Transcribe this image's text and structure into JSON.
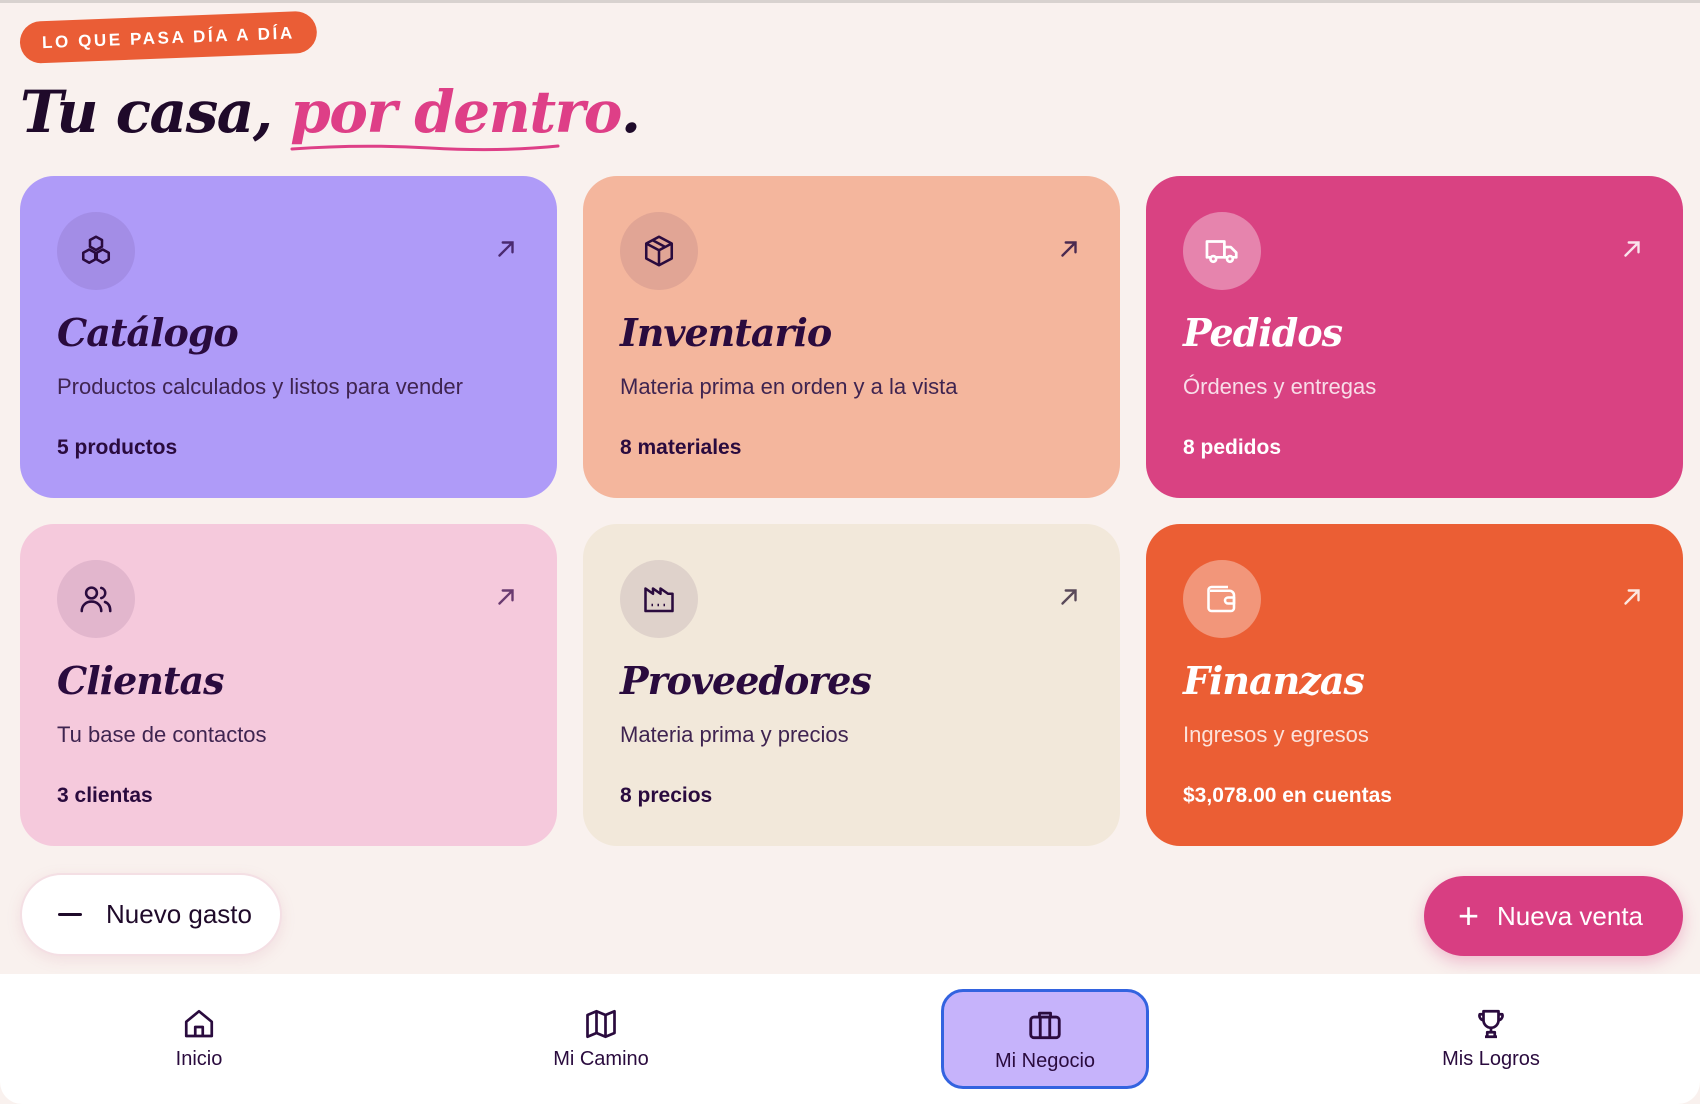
{
  "header": {
    "eyebrow": "LO QUE PASA DÍA A DÍA",
    "title_main": "Tu casa,",
    "title_accent": "por dentro",
    "title_end": "."
  },
  "cards": [
    {
      "title": "Catálogo",
      "description": "Productos calculados y listos para vender",
      "count": "5 productos",
      "icon": "cubes-icon",
      "color": "#af9bf8"
    },
    {
      "title": "Inventario",
      "description": "Materia prima en orden y a la vista",
      "count": "8 materiales",
      "icon": "box-icon",
      "color": "#f4b69d"
    },
    {
      "title": "Pedidos",
      "description": "Órdenes y entregas",
      "count": "8 pedidos",
      "icon": "truck-icon",
      "color": "#d94282"
    },
    {
      "title": "Clientas",
      "description": "Tu base de contactos",
      "count": "3 clientas",
      "icon": "users-icon",
      "color": "#f5c9dc"
    },
    {
      "title": "Proveedores",
      "description": "Materia prima y precios",
      "count": "8 precios",
      "icon": "factory-icon",
      "color": "#f2e8da"
    },
    {
      "title": "Finanzas",
      "description": "Ingresos y egresos",
      "count": "$3,078.00 en cuentas",
      "icon": "wallet-icon",
      "color": "#eb5e34"
    }
  ],
  "actions": {
    "expense_label": "Nuevo gasto",
    "sale_label": "Nueva venta"
  },
  "nav": [
    {
      "label": "Inicio",
      "icon": "home-icon"
    },
    {
      "label": "Mi Camino",
      "icon": "map-icon"
    },
    {
      "label": "Mi Negocio",
      "icon": "briefcase-icon",
      "active": true
    },
    {
      "label": "Mis Logros",
      "icon": "trophy-icon"
    }
  ]
}
